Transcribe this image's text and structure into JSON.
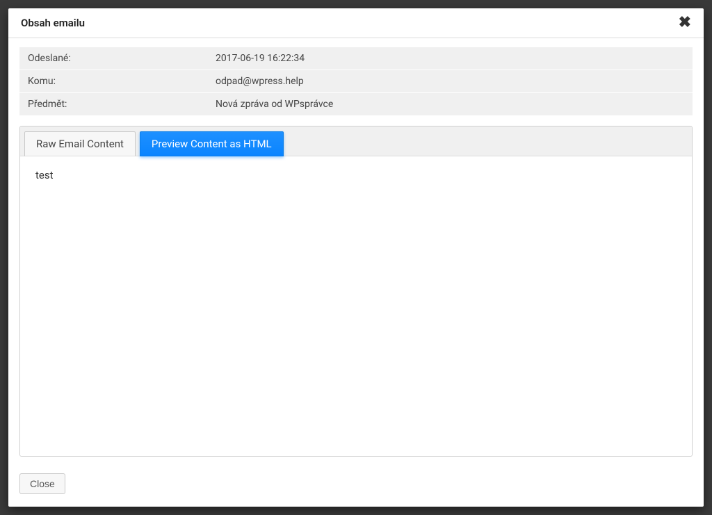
{
  "modal": {
    "title": "Obsah emailu",
    "close_x": "✖",
    "details": {
      "sent_label": "Odeslané:",
      "sent_value": "2017-06-19 16:22:34",
      "to_label": "Komu:",
      "to_value": "odpad@wpress.help",
      "subject_label": "Předmět:",
      "subject_value": "Nová zpráva od WPsprávce"
    },
    "tabs": {
      "raw": "Raw Email Content",
      "preview": "Preview Content as HTML"
    },
    "content": "test",
    "footer": {
      "close": "Close"
    }
  }
}
